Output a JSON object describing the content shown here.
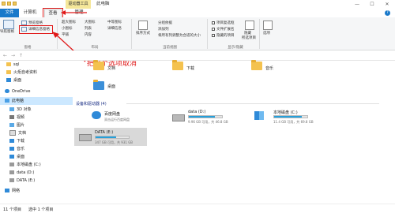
{
  "titlebar": {
    "context_tab": "驱动器工具",
    "window_title": "此电脑",
    "minimize": "—",
    "maximize": "☐",
    "close": "✕"
  },
  "tabs": {
    "file": "文件",
    "computer": "计算机",
    "view": "查看",
    "manage": "管理",
    "help": "?"
  },
  "ribbon": {
    "nav_pane_label": "导航窗格",
    "preview_pane": "预览窗格",
    "details_pane": "详细信息窗格",
    "panes_group": "窗格",
    "layout_items": [
      "超大图标",
      "大图标",
      "中等图标",
      "小图标",
      "列表",
      "详细信息",
      "平铺",
      "内容"
    ],
    "layout_group": "布局",
    "sort_by": "排序方式",
    "group_by": "分组依据",
    "add_column": "添加列",
    "fit_columns": "将所有列调整为合适的大小",
    "current_view_group": "当前视图",
    "item_checkboxes": "项目复选框",
    "file_extensions": "文件扩展名",
    "hidden_items": "隐藏的项目",
    "hide_selected": "隐藏",
    "hide_selected_2": "所选项目",
    "show_hide_group": "显示/隐藏",
    "options": "选项"
  },
  "annotation": "把这个选项取消",
  "nav": {
    "items": [
      "sql",
      "火炬自考资料",
      "桌面",
      "OneDrive",
      "此电脑",
      "3D 对象",
      "视频",
      "图片",
      "文档",
      "下载",
      "音乐",
      "桌面",
      "本地磁盘 (C:)",
      "data (D:)",
      "DATA (E:)",
      "网络"
    ]
  },
  "content": {
    "folders": [
      {
        "name": "文档"
      },
      {
        "name": "下载"
      },
      {
        "name": "音乐"
      },
      {
        "name": "桌面"
      }
    ],
    "devices_header": "设备和驱动器 (4)",
    "drives": [
      {
        "name": "百度网盘",
        "sub": "双击运行百度网盘",
        "fill": null
      },
      {
        "name": "data (D:)",
        "sub": "9.96 GB 可用，共 46.8 GB",
        "fill": 0.79
      },
      {
        "name": "本地磁盘 (C:)",
        "sub": "11.4 GB 可用，共 69.8 GB",
        "fill": 0.84
      },
      {
        "name": "DATA (E:)",
        "sub": "347 GB 可用，共 931 GB",
        "fill": 0.63
      }
    ]
  },
  "status": {
    "item_count": "11 个项目",
    "selected": "选中 1 个项目"
  },
  "colors": {
    "accent": "#1979ca",
    "annotation": "#e01818",
    "drive_fill": "#26a0da",
    "selection": "#cce8ff"
  }
}
